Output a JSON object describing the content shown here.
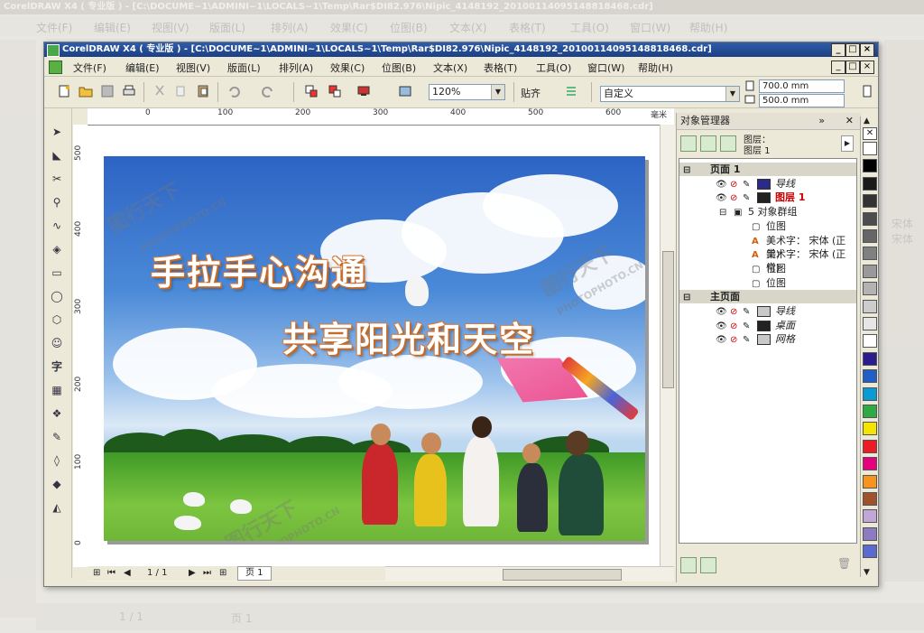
{
  "window_title": "CorelDRAW X4 ( 专业版 ) - [C:\\DOCUME~1\\ADMINI~1\\LOCALS~1\\Temp\\Rar$DI82.976\\Nipic_4148192_20100114095148818468.cdr]",
  "window_buttons": {
    "minimize": "_",
    "restore": "□",
    "close": "×"
  },
  "menu": [
    "文件(F)",
    "编辑(E)",
    "视图(V)",
    "版面(L)",
    "排列(A)",
    "效果(C)",
    "位图(B)",
    "文本(X)",
    "表格(T)",
    "工具(O)",
    "窗口(W)",
    "帮助(H)"
  ],
  "toolbar": {
    "zoom": "120%",
    "snap_label": "贴齐",
    "page_preset": "自定义",
    "width": "700.0 mm",
    "height": "500.0 mm"
  },
  "ruler": {
    "unit": "毫米",
    "h_ticks": [
      "0",
      "100",
      "200",
      "300",
      "400",
      "500",
      "600"
    ],
    "v_ticks": [
      "500",
      "400",
      "300",
      "200",
      "100",
      "0"
    ]
  },
  "poster": {
    "line1": "手拉手心沟通",
    "line2": "共享阳光和天空"
  },
  "watermark": {
    "cn": "图行天下",
    "en": "PHOTOPHOTO.CN"
  },
  "page_nav": {
    "position": "1 / 1",
    "tab": "页 1"
  },
  "object_manager": {
    "title": "对象管理器",
    "layer_label": "图层：",
    "layer_value": "图层 1",
    "rows": [
      {
        "text": "页面 1",
        "type": "header"
      },
      {
        "text": "导线",
        "type": "layer",
        "color": "#2a2a8a"
      },
      {
        "text": "图层 1",
        "type": "layer-active",
        "color": "#222222"
      },
      {
        "text": "5 对象群组",
        "type": "group"
      },
      {
        "text": "位图",
        "type": "item"
      },
      {
        "text": "美术字： 宋体 (正常)",
        "type": "item"
      },
      {
        "text": "美术字： 宋体 (正常)",
        "type": "item"
      },
      {
        "text": "位图",
        "type": "item"
      },
      {
        "text": "位图",
        "type": "item"
      },
      {
        "text": "主页面",
        "type": "header"
      },
      {
        "text": "导线",
        "type": "layer",
        "color": "#c8c8c8"
      },
      {
        "text": "桌面",
        "type": "layer",
        "color": "#222222"
      },
      {
        "text": "网格",
        "type": "layer",
        "color": "#c8c8c8"
      }
    ]
  },
  "palette": [
    "#ffffff",
    "#000000",
    "#1a1a1a",
    "#333333",
    "#4d4d4d",
    "#666666",
    "#808080",
    "#999999",
    "#b3b3b3",
    "#cccccc",
    "#e6e6e6",
    "#ffffff",
    "#2b1c8e",
    "#1f5fc6",
    "#0a9bd6",
    "#2eaa44",
    "#f5e400",
    "#ed1c24",
    "#e6007e",
    "#f7941d",
    "#a0522d",
    "#c3a6d8",
    "#8c7bc0",
    "#5a6ad0"
  ],
  "ghost": {
    "title": "CorelDRAW X4 ( 专业版 ) - [C:\\DOCUME~1\\ADMINI~1\\LOCALS~1\\Temp\\Rar$DI82.976\\Nipic_4148192_20100114095148818468.cdr]",
    "menu": [
      "文件(F)",
      "编辑(E)",
      "视图(V)",
      "版面(L)",
      "排列(A)",
      "效果(C)",
      "位图(B)",
      "文本(X)",
      "表格(T)",
      "工具(O)",
      "窗口(W)",
      "帮助(H)"
    ],
    "side_text": "宋体",
    "page_pos": "1 / 1",
    "page_tab": "页 1"
  }
}
